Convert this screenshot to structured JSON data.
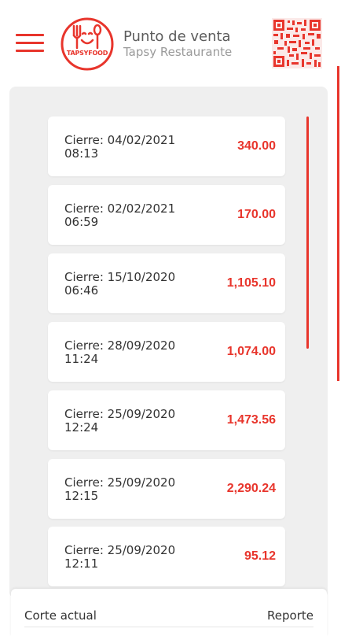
{
  "header": {
    "logo_text": "TAPSYFOOD",
    "title": "Punto de venta",
    "subtitle": "Tapsy Restaurante",
    "icons": {
      "menu": "hamburger-icon",
      "qr": "qr-code-icon"
    },
    "accent_color": "#e8352c"
  },
  "cierres": [
    {
      "label": "Cierre: 04/02/2021\n08:13",
      "amount": "340.00"
    },
    {
      "label": "Cierre: 02/02/2021\n06:59",
      "amount": "170.00"
    },
    {
      "label": "Cierre: 15/10/2020\n06:46",
      "amount": "1,105.10"
    },
    {
      "label": "Cierre: 28/09/2020\n11:24",
      "amount": "1,074.00"
    },
    {
      "label": "Cierre: 25/09/2020\n12:24",
      "amount": "1,473.56"
    },
    {
      "label": "Cierre: 25/09/2020\n12:15",
      "amount": "2,290.24"
    },
    {
      "label": "Cierre: 25/09/2020\n12:11",
      "amount": "95.12"
    }
  ],
  "footer": {
    "left_tab": "Corte actual",
    "right_tab": "Reporte"
  }
}
